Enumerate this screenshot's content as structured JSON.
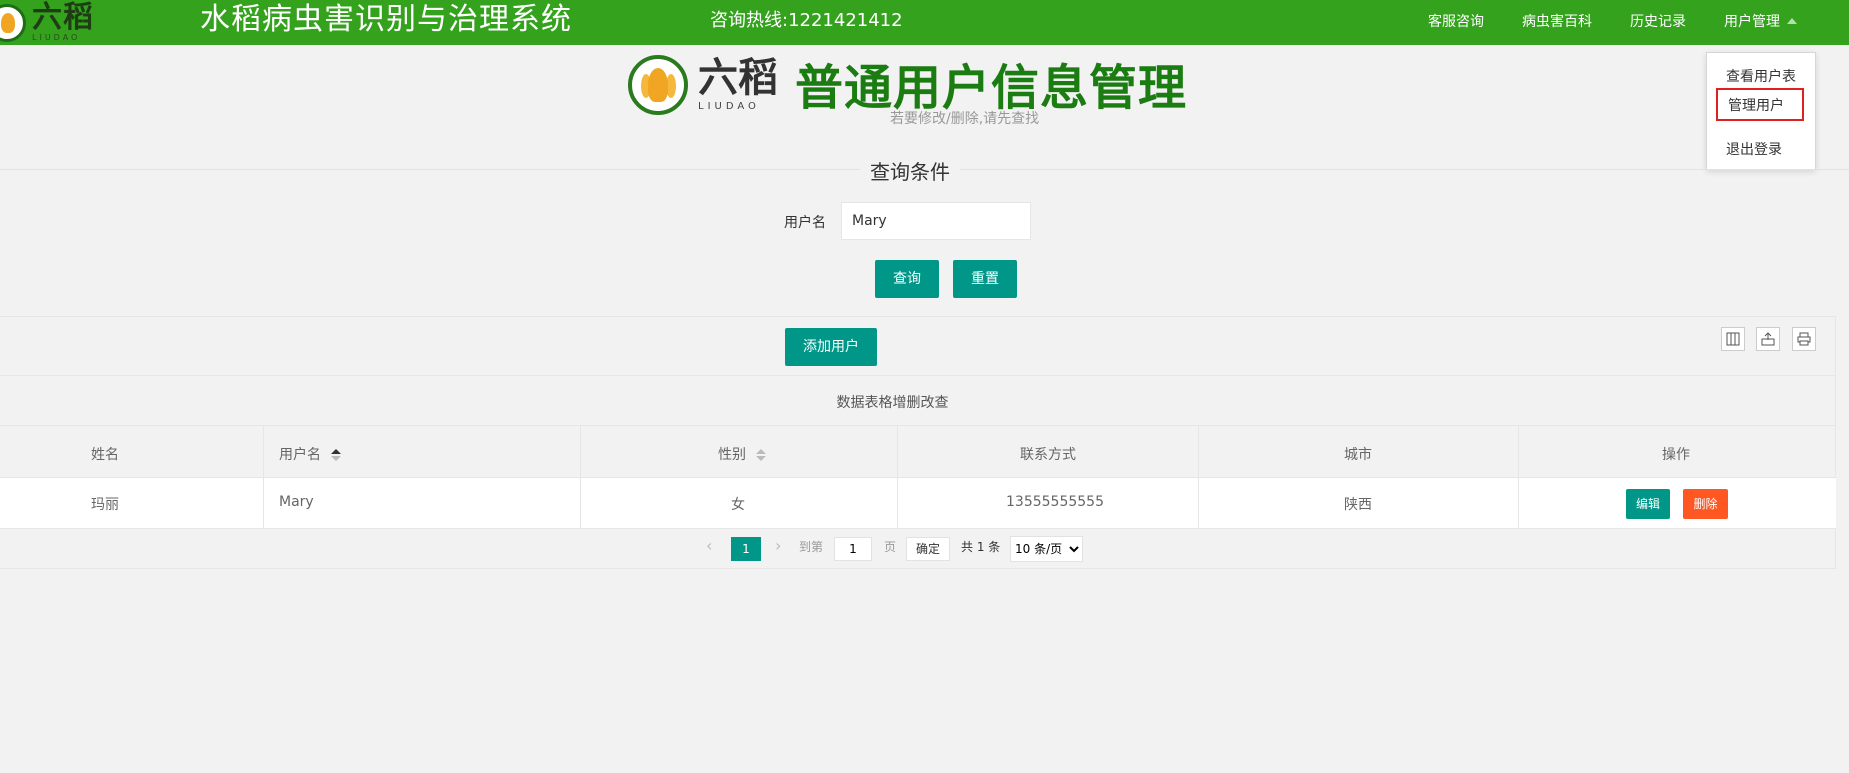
{
  "brand": {
    "logo_cn": "六稻",
    "logo_en": "LIUDAO",
    "system_title": "水稻病虫害识别与治理系统",
    "hotline": "咨询热线:1221421412"
  },
  "nav": {
    "items": [
      {
        "label": "客服咨询"
      },
      {
        "label": "病虫害百科"
      },
      {
        "label": "历史记录"
      },
      {
        "label": "用户管理"
      }
    ]
  },
  "dropdown": {
    "items": [
      {
        "label": "查看用户表"
      },
      {
        "label": "管理用户"
      },
      {
        "label": "退出登录"
      }
    ],
    "selected": "管理用户"
  },
  "page": {
    "title": "普通用户信息管理",
    "subtitle": "若要修改/删除,请先查找"
  },
  "query": {
    "legend": "查询条件",
    "username_label": "用户名",
    "username_value": "Mary",
    "search_label": "查询",
    "reset_label": "重置"
  },
  "toolbar": {
    "add_label": "添加用户",
    "icons": [
      "columns-icon",
      "export-icon",
      "print-icon"
    ]
  },
  "table": {
    "title": "数据表格增删改查",
    "headers": [
      "姓名",
      "用户名",
      "性别",
      "联系方式",
      "城市",
      "操作"
    ],
    "rows": [
      {
        "name": "玛丽",
        "username": "Mary",
        "gender": "女",
        "phone": "13555555555",
        "city": "陕西"
      }
    ],
    "edit_label": "编辑",
    "delete_label": "删除"
  },
  "pager": {
    "current": "1",
    "goto_label": "到第",
    "goto_value": "1",
    "page_unit": "页",
    "confirm_label": "确定",
    "total": "共 1 条",
    "page_size": "10 条/页"
  },
  "colors": {
    "topbar": "#34a21d",
    "title_green": "#1b7c12",
    "teal": "#009688",
    "danger": "#ff5722",
    "highlight_border": "#e02020"
  }
}
